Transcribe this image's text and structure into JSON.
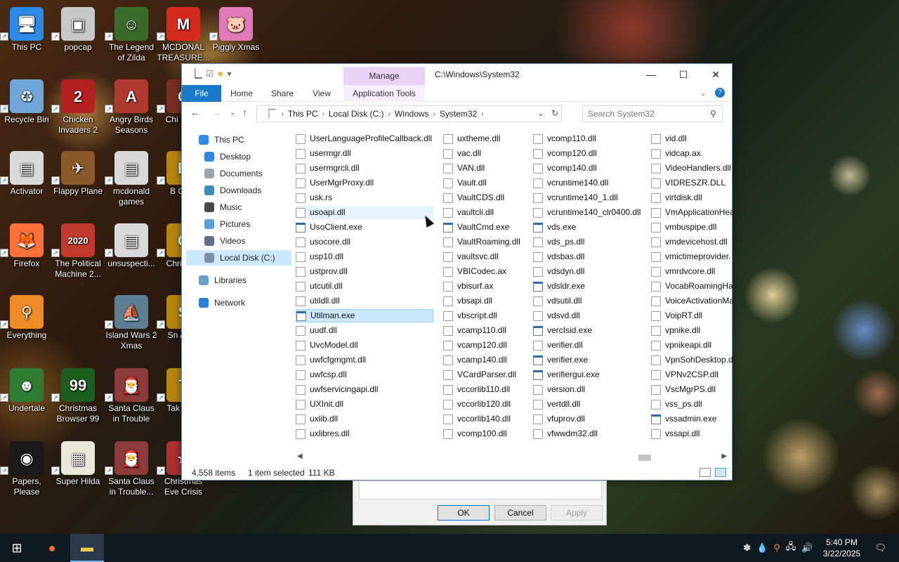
{
  "desktop": {
    "icons": [
      {
        "label": "This PC",
        "color": "#2b8be6",
        "glyph": "🖥"
      },
      {
        "label": "popcap",
        "color": "#c8c8c8",
        "glyph": "▣"
      },
      {
        "label": "The Legend of Zilda",
        "color": "#3a6b2a",
        "glyph": "☺"
      },
      {
        "label": "MCDONAL TREASURE...",
        "color": "#d52b1e",
        "glyph": "M"
      },
      {
        "label": "Piggly Xmas",
        "color": "#e07ab8",
        "glyph": "🐷"
      },
      {
        "label": "Recycle Bin",
        "color": "#6fa7d8",
        "glyph": "♻"
      },
      {
        "label": "Chicken Invaders 2",
        "color": "#b52020",
        "glyph": "2"
      },
      {
        "label": "Angry Birds Seasons",
        "color": "#b03a2e",
        "glyph": "A"
      },
      {
        "label": "Chi Invad",
        "color": "#7a3020",
        "glyph": "C"
      },
      {
        "label": "Activator",
        "color": "#d9d9d9",
        "glyph": "▤"
      },
      {
        "label": "Flappy Plane",
        "color": "#8b5a2b",
        "glyph": "✈"
      },
      {
        "label": "mcdonald games",
        "color": "#d9d9d9",
        "glyph": "▤"
      },
      {
        "label": "B Orna",
        "color": "#b8860b",
        "glyph": "B"
      },
      {
        "label": "Firefox",
        "color": "#ff7139",
        "glyph": "🦊"
      },
      {
        "label": "The Political Machine 2...",
        "color": "#c0392b",
        "glyph": "2020"
      },
      {
        "label": "unsuspecti...",
        "color": "#d9d9d9",
        "glyph": "▤"
      },
      {
        "label": "Chri Swe",
        "color": "#b8860b",
        "glyph": "C"
      },
      {
        "label": "Everything",
        "color": "#f08a24",
        "glyph": "⚲"
      },
      {
        "label": "Island Wars 2 Xmas",
        "color": "#5c7f94",
        "glyph": "⛵"
      },
      {
        "label": "Sn Anim",
        "color": "#b8860b",
        "glyph": "S"
      },
      {
        "label": "Undertale",
        "color": "#2e7d32",
        "glyph": "☻"
      },
      {
        "label": "Christmas Browser 99",
        "color": "#1b5e20",
        "glyph": "99"
      },
      {
        "label": "Santa Claus in Trouble",
        "color": "#8e3b3b",
        "glyph": "🎅"
      },
      {
        "label": "Tak Brea",
        "color": "#b8860b",
        "glyph": "T"
      },
      {
        "label": "Papers, Please",
        "color": "#1a1a1a",
        "glyph": "◉"
      },
      {
        "label": "Super Hilda",
        "color": "#e8e8d8",
        "glyph": "▦"
      },
      {
        "label": "Santa Claus in Trouble...",
        "color": "#8e3b3b",
        "glyph": "🎅"
      },
      {
        "label": "Christmas Eve Crisis",
        "color": "#b03030",
        "glyph": "★"
      }
    ]
  },
  "window": {
    "title": "C:\\Windows\\System32",
    "manage_tab": "Manage",
    "tabs": [
      "File",
      "Home",
      "Share",
      "View",
      "Application Tools"
    ],
    "address": [
      "This PC",
      "Local Disk (C:)",
      "Windows",
      "System32"
    ],
    "search_placeholder": "Search System32",
    "nav": [
      "This PC",
      "Desktop",
      "Documents",
      "Downloads",
      "Music",
      "Pictures",
      "Videos",
      "Local Disk (C:)",
      "Libraries",
      "Network"
    ],
    "nav_colors": [
      "#2b8be6",
      "#2e86de",
      "#9aa5b1",
      "#3c8dbc",
      "#4a4a4a",
      "#5aa0d8",
      "#5e6f86",
      "#7a8fa6",
      "#6aa0c8",
      "#2b7fd4"
    ],
    "files": [
      [
        "UserLanguageProfileCallback.dll",
        "usermgr.dll",
        "usermgrcli.dll",
        "UserMgrProxy.dll",
        "usk.rs",
        "usoapi.dll",
        "UsoClient.exe",
        "usocore.dll",
        "usp10.dll",
        "ustprov.dll",
        "utcutil.dll",
        "utildll.dll",
        "Utilman.exe",
        "uudf.dll",
        "UvcModel.dll",
        "uwfcfgmgmt.dll",
        "uwfcsp.dll",
        "uwfservicingapi.dll",
        "UXInit.dll",
        "uxlib.dll",
        "uxlibres.dll"
      ],
      [
        "uxtheme.dll",
        "vac.dll",
        "VAN.dll",
        "Vault.dll",
        "VaultCDS.dll",
        "vaultcli.dll",
        "VaultCmd.exe",
        "VaultRoaming.dll",
        "vaultsvc.dll",
        "VBICodec.ax",
        "vbisurf.ax",
        "vbsapi.dll",
        "vbscript.dll",
        "vcamp110.dll",
        "vcamp120.dll",
        "vcamp140.dll",
        "VCardParser.dll",
        "vccorlib110.dll",
        "vccorlib120.dll",
        "vccorlib140.dll",
        "vcomp100.dll"
      ],
      [
        "vcomp110.dll",
        "vcomp120.dll",
        "vcomp140.dll",
        "vcruntime140.dll",
        "vcruntime140_1.dll",
        "vcruntime140_clr0400.dll",
        "vds.exe",
        "vds_ps.dll",
        "vdsbas.dll",
        "vdsdyn.dll",
        "vdsldr.exe",
        "vdsutil.dll",
        "vdsvd.dll",
        "vercIsid.exe",
        "verifier.dll",
        "verifier.exe",
        "verifiergui.exe",
        "version.dll",
        "vertdll.dll",
        "vfuprov.dll",
        "vfwwdm32.dll"
      ],
      [
        "vid.dll",
        "vidcap.ax",
        "VideoHandlers.dll",
        "VIDRESZR.DLL",
        "virtdisk.dll",
        "VmApplicationHea",
        "vmbuspipe.dll",
        "vmdevicehost.dll",
        "vmictimeprovider.",
        "vmrdvcore.dll",
        "VocabRoamingHar",
        "VoiceActivationMa",
        "VoipRT.dll",
        "vpnike.dll",
        "vpnikeapi.dll",
        "VpnSohDesktop.dl",
        "VPNv2CSP.dll",
        "VscMgrPS.dll",
        "vss_ps.dll",
        "vssadmin.exe",
        "vssapi.dll"
      ]
    ],
    "status": {
      "items": "4,558 items",
      "selected": "1 item selected",
      "size": "111 KB"
    }
  },
  "dialog": {
    "ok": "OK",
    "cancel": "Cancel",
    "apply": "Apply"
  },
  "taskbar": {
    "time": "5:40 PM",
    "date": "3/22/2025"
  }
}
